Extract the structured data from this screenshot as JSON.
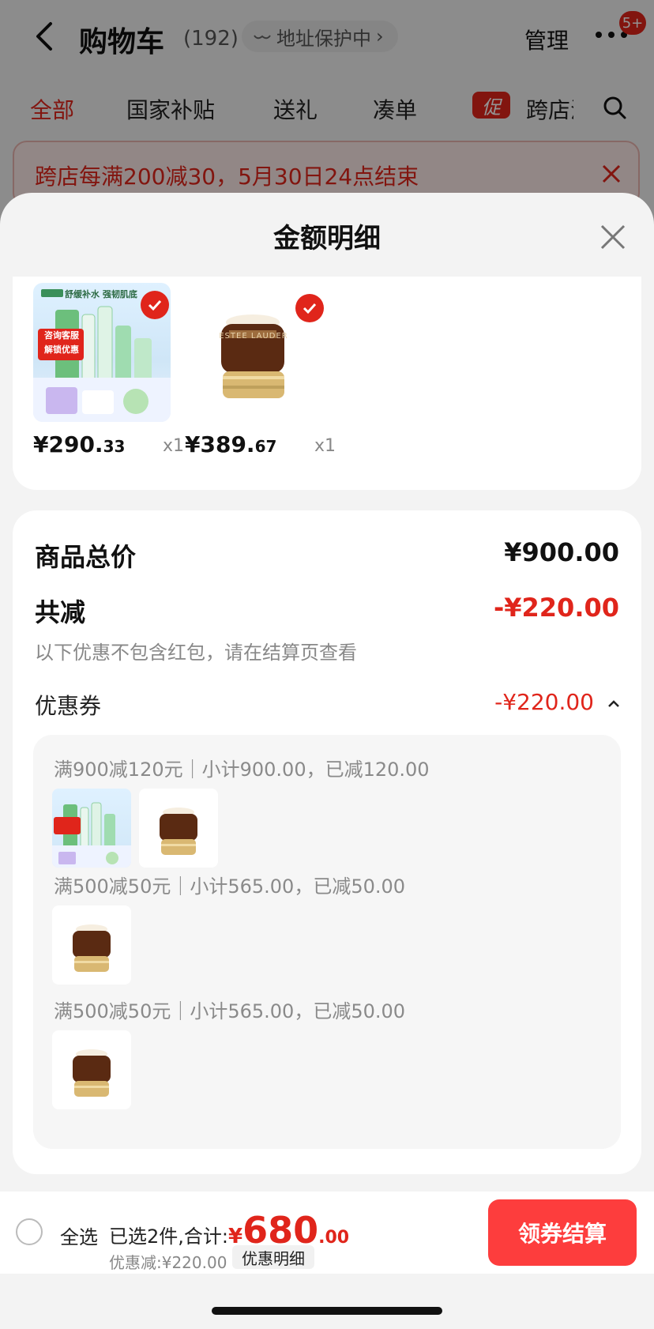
{
  "background_page": {
    "title": "购物车",
    "count": "(192)",
    "address_protection": "地址保护中",
    "manage_label": "管理",
    "badge": "5+",
    "tabs": [
      "全部",
      "国家补贴",
      "送礼",
      "凑单",
      "跨店满"
    ],
    "promo_tag": "促",
    "promo_banner": "跨店每满200减30，5月30日24点结束"
  },
  "sheet": {
    "title": "金额明细",
    "items": [
      {
        "thumb_text_top": "舒缓补水 强韧肌底",
        "thumb_text_badge": "咨询客服\n解锁优惠",
        "price_int": "¥290.",
        "price_dec": "33",
        "qty": "x1"
      },
      {
        "thumb_brand": "ESTEE LAUDER",
        "price_int": "¥389.",
        "price_dec": "67",
        "qty": "x1"
      }
    ],
    "summary": {
      "total_label": "商品总价",
      "total_value": "¥900.00",
      "reduce_label": "共减",
      "reduce_value": "-¥220.00",
      "note": "以下优惠不包含红包，请在结算页查看",
      "coupon_label": "优惠券",
      "coupon_value": "-¥220.00"
    },
    "coupons": [
      {
        "rule": "满900减120元｜小计900.00，已减120.00"
      },
      {
        "rule": "满500减50元｜小计565.00，已减50.00"
      },
      {
        "rule": "满500减50元｜小计565.00，已减50.00"
      }
    ]
  },
  "bottom_bar": {
    "select_all": "全选",
    "selected_text": "已选2件,合计:",
    "yen": "¥",
    "total_int": "680",
    "total_dec": ".00",
    "discount_text": "优惠减:¥220.00",
    "detail_chip": "优惠明细",
    "checkout": "领券结算"
  },
  "colors": {
    "accent": "#e0251b",
    "checkout": "#fd3d3d",
    "sheet_bg": "#f3f3f3"
  }
}
